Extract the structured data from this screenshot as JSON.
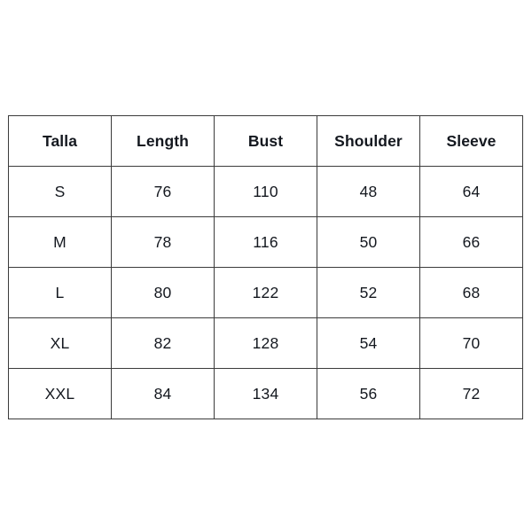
{
  "table": {
    "columns": [
      "Talla",
      "Length",
      "Bust",
      "Shoulder",
      "Sleeve"
    ],
    "rows": [
      {
        "cells": [
          "S",
          "76",
          "110",
          "48",
          "64"
        ]
      },
      {
        "cells": [
          "M",
          "78",
          "116",
          "50",
          "66"
        ]
      },
      {
        "cells": [
          "L",
          "80",
          "122",
          "52",
          "68"
        ]
      },
      {
        "cells": [
          "XL",
          "82",
          "128",
          "54",
          "70"
        ]
      },
      {
        "cells": [
          "XXL",
          "84",
          "134",
          "56",
          "72"
        ]
      }
    ]
  },
  "chart_data": {
    "type": "table",
    "title": "",
    "columns": [
      "Talla",
      "Length",
      "Bust",
      "Shoulder",
      "Sleeve"
    ],
    "rows": [
      [
        "S",
        76,
        110,
        48,
        64
      ],
      [
        "M",
        78,
        116,
        50,
        66
      ],
      [
        "L",
        80,
        122,
        52,
        68
      ],
      [
        "XL",
        82,
        128,
        54,
        70
      ],
      [
        "XXL",
        84,
        134,
        56,
        72
      ]
    ],
    "series": [
      {
        "name": "Length",
        "categories": [
          "S",
          "M",
          "L",
          "XL",
          "XXL"
        ],
        "values": [
          76,
          78,
          80,
          82,
          84
        ]
      },
      {
        "name": "Bust",
        "categories": [
          "S",
          "M",
          "L",
          "XL",
          "XXL"
        ],
        "values": [
          110,
          116,
          122,
          128,
          134
        ]
      },
      {
        "name": "Shoulder",
        "categories": [
          "S",
          "M",
          "L",
          "XL",
          "XXL"
        ],
        "values": [
          48,
          50,
          52,
          54,
          56
        ]
      },
      {
        "name": "Sleeve",
        "categories": [
          "S",
          "M",
          "L",
          "XL",
          "XXL"
        ],
        "values": [
          64,
          66,
          68,
          70,
          72
        ]
      }
    ],
    "xlabel": "",
    "ylabel": "",
    "grid": true,
    "legend": "none"
  },
  "style": {
    "background": "#ffffff",
    "border_color": "#3b3b3b",
    "text_color": "#14181f"
  }
}
